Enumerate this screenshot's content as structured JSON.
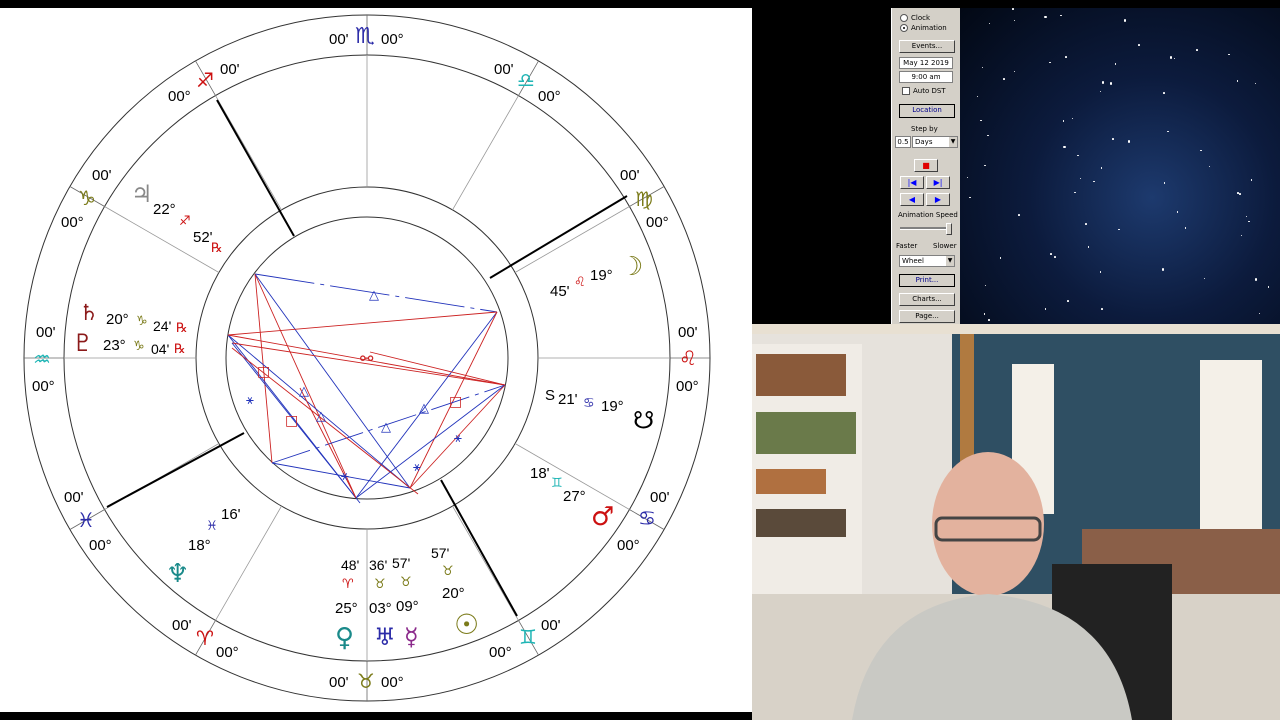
{
  "chart": {
    "sign_cusps": [
      {
        "glyph": "♏",
        "deg": "00°",
        "min": "00'",
        "color": "#2b2ba8"
      },
      {
        "glyph": "♎",
        "deg": "00°",
        "min": "00'",
        "color": "#1fb5b5"
      },
      {
        "glyph": "♍",
        "deg": "00°",
        "min": "00'",
        "color": "#7b7b1a"
      },
      {
        "glyph": "♌",
        "deg": "00°",
        "min": "00'",
        "color": "#cc1111"
      },
      {
        "glyph": "♋",
        "deg": "00°",
        "min": "00'",
        "color": "#2b2ba8"
      },
      {
        "glyph": "♊",
        "deg": "00°",
        "min": "00'",
        "color": "#1fb5b5"
      },
      {
        "glyph": "♉",
        "deg": "00°",
        "min": "00'",
        "color": "#7b7b1a"
      },
      {
        "glyph": "♈",
        "deg": "00°",
        "min": "00'",
        "color": "#cc1111"
      },
      {
        "glyph": "♓",
        "deg": "00°",
        "min": "00'",
        "color": "#2b2ba8"
      },
      {
        "glyph": "♒",
        "deg": "00°",
        "min": "00'",
        "color": "#1fb5b5"
      },
      {
        "glyph": "♑",
        "deg": "00°",
        "min": "00'",
        "color": "#7b7b1a"
      },
      {
        "glyph": "♐",
        "deg": "00°",
        "min": "00'",
        "color": "#cc1111"
      }
    ],
    "planets": [
      {
        "name": "jupiter",
        "glyph": "♃",
        "deg": "22°",
        "sign": "♐",
        "min": "52'",
        "retro": "℞",
        "color": "#888888"
      },
      {
        "name": "saturn",
        "glyph": "♄",
        "deg": "20°",
        "sign": "♑",
        "min": "24'",
        "retro": "℞",
        "color": "#8b1a1a"
      },
      {
        "name": "pluto",
        "glyph": "♇",
        "deg": "23°",
        "sign": "♑",
        "min": "04'",
        "retro": "℞",
        "color": "#8b1a1a"
      },
      {
        "name": "moon",
        "glyph": "☽",
        "deg": "19°",
        "sign": "♌",
        "min": "45'",
        "color": "#7b7b1a"
      },
      {
        "name": "node",
        "glyph": "☊",
        "deg": "19°",
        "sign": "♋",
        "min": "21'",
        "prefix": "S",
        "color": "#000000"
      },
      {
        "name": "mars",
        "glyph": "♂",
        "deg": "27°",
        "sign": "♊",
        "min": "18'",
        "color": "#cc1111"
      },
      {
        "name": "sun",
        "glyph": "☉",
        "deg": "20°",
        "sign": "♉",
        "min": "57'",
        "color": "#7b7b1a"
      },
      {
        "name": "mercury",
        "glyph": "☿",
        "deg": "09°",
        "sign": "♉",
        "min": "57'",
        "color": "#8b2a8b"
      },
      {
        "name": "uranus",
        "glyph": "♅",
        "deg": "03°",
        "sign": "♉",
        "min": "36'",
        "color": "#2b2ba8"
      },
      {
        "name": "venus",
        "glyph": "♀",
        "deg": "25°",
        "sign": "♈",
        "min": "48'",
        "color": "#1a8a8a"
      },
      {
        "name": "neptune",
        "glyph": "♆",
        "deg": "18°",
        "sign": "♓",
        "min": "16'",
        "color": "#1a8a8a"
      }
    ],
    "center_glyph": "⚯",
    "aspect_glyphs": {
      "trine": "△",
      "square": "□",
      "sextile": "⚹"
    }
  },
  "panel": {
    "mode_clock": "Clock",
    "mode_animation": "Animation",
    "events_button": "Events...",
    "date": "May 12 2019",
    "time": "9:00 am",
    "auto_dst": "Auto DST",
    "location_button": "Location",
    "step_by_label": "Step by",
    "step_value": "0.5",
    "step_unit": "Days",
    "stop_symbol": "■",
    "step_back_end": "|◀",
    "step_fwd_end": "▶|",
    "play_back": "◀",
    "play_fwd": "▶",
    "animation_speed_label": "Animation Speed",
    "faster": "Faster",
    "slower": "Slower",
    "display_select": "Wheel",
    "print_button": "Print...",
    "charts_button": "Charts...",
    "page_button": "Page..."
  },
  "colors": {
    "aspect_red": "#cc2222",
    "aspect_blue": "#2233bb",
    "panel_bg": "#d4d0c8"
  }
}
